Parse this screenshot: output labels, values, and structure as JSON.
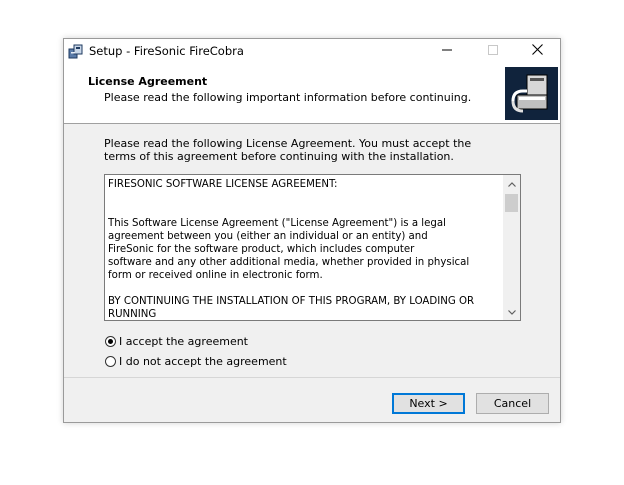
{
  "window": {
    "title": "Setup - FireSonic FireCobra"
  },
  "header": {
    "title": "License Agreement",
    "subtitle": "Please read the following important information before continuing."
  },
  "content": {
    "intro": "Please read the following License Agreement. You must accept the terms of this agreement before continuing with the installation.",
    "license_text": "FIRESONIC SOFTWARE LICENSE AGREEMENT:\n\n\nThis Software License Agreement (\"License Agreement\") is a legal\nagreement between you (either an individual or an entity) and\nFireSonic for the software product, which includes computer\nsoftware and any other additional media, whether provided in physical\nform or received online in electronic form.\n\nBY CONTINUING THE INSTALLATION OF THIS PROGRAM, BY LOADING OR\nRUNNING",
    "options": [
      {
        "label": "I accept the agreement",
        "selected": true
      },
      {
        "label": "I do not accept the agreement",
        "selected": false
      }
    ]
  },
  "buttons": {
    "next": "Next >",
    "cancel": "Cancel"
  },
  "colors": {
    "accent": "#0078d7",
    "header_image_bg": "#10233c"
  }
}
